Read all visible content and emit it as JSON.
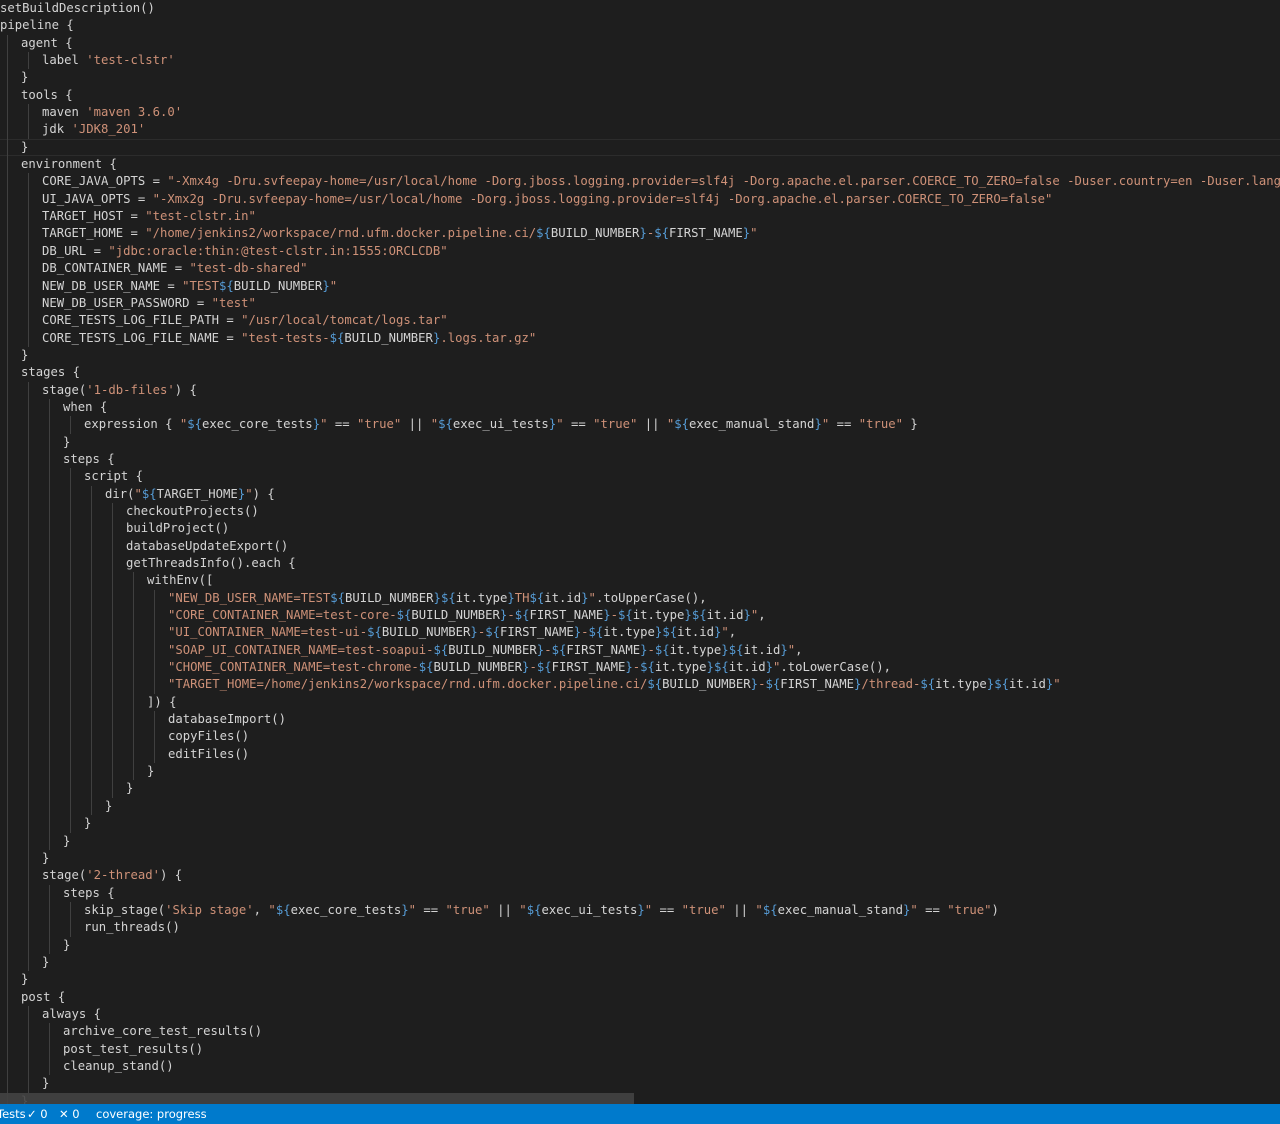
{
  "editor": {
    "lines": [
      "setBuildDescription()",
      "pipeline {",
      "    agent {",
      "        label 'test-clstr'",
      "    }",
      "    tools {",
      "        maven 'maven 3.6.0'",
      "        jdk 'JDK8_201'",
      "    }",
      "    environment {",
      "        CORE_JAVA_OPTS = \"-Xmx4g -Dru.svfeepay-home=/usr/local/home -Dorg.jboss.logging.provider=slf4j -Dorg.apache.el.parser.COERCE_TO_ZERO=false -Duser.country=en -Duser.language=en -Duser.region=US\"",
      "        UI_JAVA_OPTS = \"-Xmx2g -Dru.svfeepay-home=/usr/local/home -Dorg.jboss.logging.provider=slf4j -Dorg.apache.el.parser.COERCE_TO_ZERO=false\"",
      "        TARGET_HOST = \"test-clstr.in\"",
      "        TARGET_HOME = \"/home/jenkins2/workspace/rnd.ufm.docker.pipeline.ci/${BUILD_NUMBER}-${FIRST_NAME}\"",
      "        DB_URL = \"jdbc:oracle:thin:@test-clstr.in:1555:ORCLCDB\"",
      "        DB_CONTAINER_NAME = \"test-db-shared\"",
      "        NEW_DB_USER_NAME = \"TEST${BUILD_NUMBER}\"",
      "        NEW_DB_USER_PASSWORD = \"test\"",
      "        CORE_TESTS_LOG_FILE_PATH = \"/usr/local/tomcat/logs.tar\"",
      "        CORE_TESTS_LOG_FILE_NAME = \"test-tests-${BUILD_NUMBER}.logs.tar.gz\"",
      "    }",
      "    stages {",
      "        stage('1-db-files') {",
      "            when {",
      "                expression { \"${exec_core_tests}\" == \"true\" || \"${exec_ui_tests}\" == \"true\" || \"${exec_manual_stand}\" == \"true\" }",
      "            }",
      "            steps {",
      "                script {",
      "                    dir(\"${TARGET_HOME}\") {",
      "                        checkoutProjects()",
      "                        buildProject()",
      "                        databaseUpdateExport()",
      "                        getThreadsInfo().each {",
      "                            withEnv([",
      "                                \"NEW_DB_USER_NAME=TEST${BUILD_NUMBER}${it.type}TH${it.id}\".toUpperCase(),",
      "                                \"CORE_CONTAINER_NAME=test-core-${BUILD_NUMBER}-${FIRST_NAME}-${it.type}${it.id}\",",
      "                                \"UI_CONTAINER_NAME=test-ui-${BUILD_NUMBER}-${FIRST_NAME}-${it.type}${it.id}\",",
      "                                \"SOAP_UI_CONTAINER_NAME=test-soapui-${BUILD_NUMBER}-${FIRST_NAME}-${it.type}${it.id}\",",
      "                                \"CHOME_CONTAINER_NAME=test-chrome-${BUILD_NUMBER}-${FIRST_NAME}-${it.type}${it.id}\".toLowerCase(),",
      "                                \"TARGET_HOME=/home/jenkins2/workspace/rnd.ufm.docker.pipeline.ci/${BUILD_NUMBER}-${FIRST_NAME}/thread-${it.type}${it.id}\"",
      "                            ]) {",
      "                                databaseImport()",
      "                                copyFiles()",
      "                                editFiles()",
      "                            }",
      "                        }",
      "                    }",
      "                }",
      "            }",
      "        }",
      "        stage('2-thread') {",
      "            steps {",
      "                skip_stage('Skip stage', \"${exec_core_tests}\" == \"true\" || \"${exec_ui_tests}\" == \"true\" || \"${exec_manual_stand}\" == \"true\")",
      "                run_threads()",
      "            }",
      "        }",
      "    }",
      "    post {",
      "        always {",
      "            archive_core_test_results()",
      "            post_test_results()",
      "            cleanup_stand()",
      "        }",
      "    }"
    ],
    "current_line": 8
  },
  "statusbar": {
    "tests_label": "Tests",
    "passed": "✓ 0",
    "failed": "✕ 0",
    "coverage": "coverage: progress"
  },
  "colors": {
    "background": "#1e1e1e",
    "text": "#d4d4d4",
    "string": "#ce9178",
    "interpolation": "#569cd6",
    "statusbar": "#007acc"
  }
}
